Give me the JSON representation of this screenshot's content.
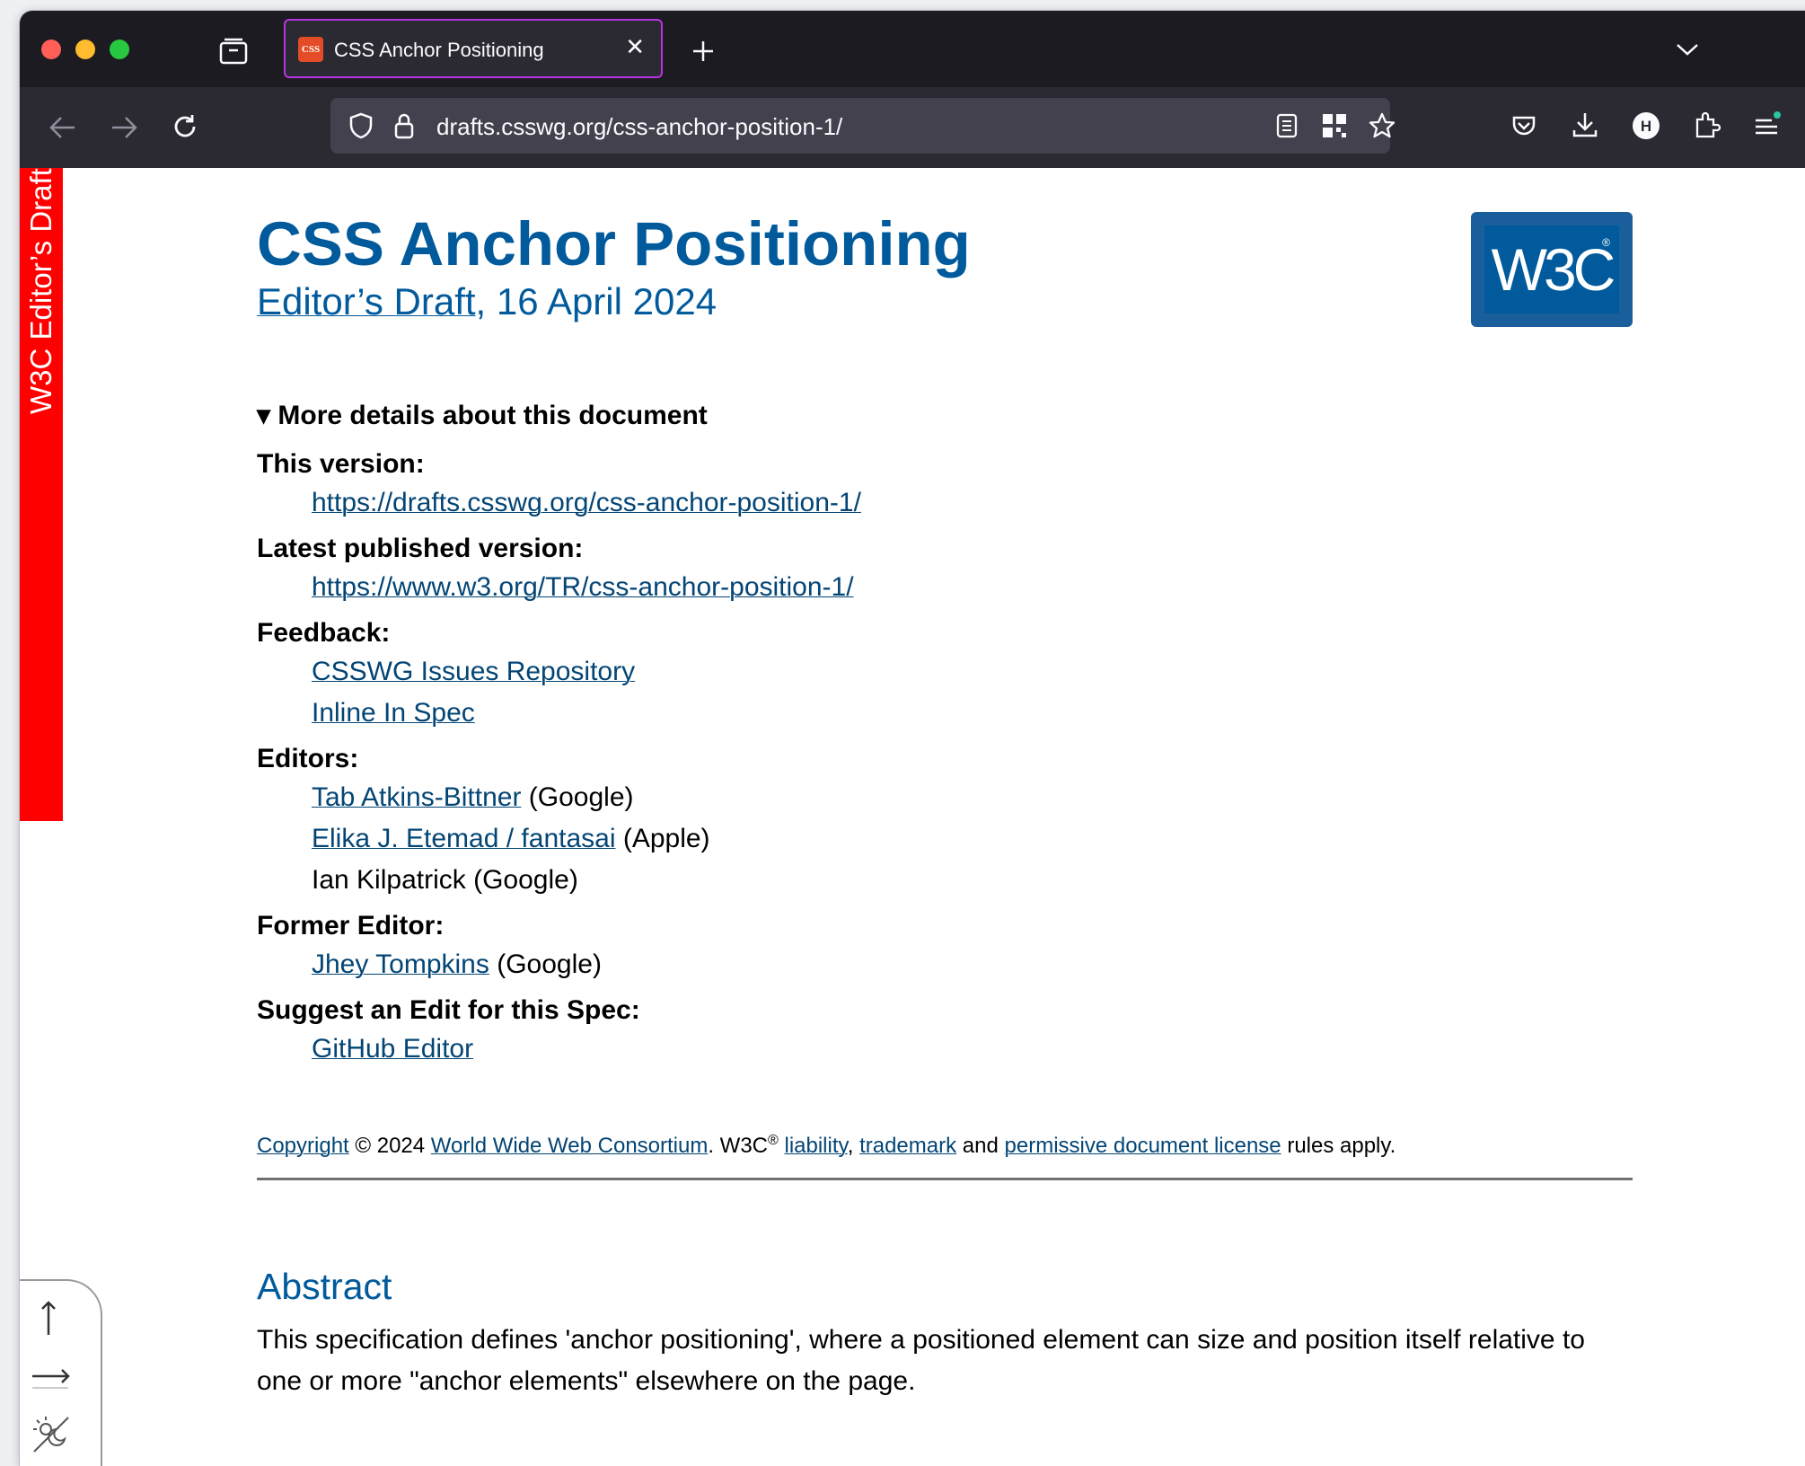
{
  "browser": {
    "tab_title": "CSS Anchor Positioning",
    "tab_favicon_text": "CSS",
    "url": "drafts.csswg.org/css-anchor-position-1/"
  },
  "page": {
    "ribbon": "W3C Editor’s Draft",
    "title": "CSS Anchor Positioning",
    "subtitle_link": "Editor’s Draft",
    "subtitle_date": ", 16 April 2024",
    "logo_text": "W3C",
    "logo_mark": "®",
    "details_summary": "▾ More details about this document",
    "details": {
      "this_version_label": "This version:",
      "this_version_url": "https://drafts.csswg.org/css-anchor-position-1/",
      "latest_label": "Latest published version:",
      "latest_url": "https://www.w3.org/TR/css-anchor-position-1/",
      "feedback_label": "Feedback:",
      "feedback_items": [
        "CSSWG Issues Repository",
        "Inline In Spec"
      ],
      "editors_label": "Editors:",
      "editors": [
        {
          "name": "Tab Atkins-Bittner",
          "org": " (Google)"
        },
        {
          "name": "Elika J. Etemad / fantasai",
          "org": " (Apple)"
        },
        {
          "name": "Ian Kilpatrick",
          "org": " (Google)"
        }
      ],
      "former_editor_label": "Former Editor:",
      "former_editor": {
        "name": "Jhey Tompkins",
        "org": " (Google)"
      },
      "suggest_label": "Suggest an Edit for this Spec:",
      "suggest_link": "GitHub Editor"
    },
    "copyright": {
      "copyright_link": "Copyright",
      "year_text": " © 2024 ",
      "consortium": "World Wide Web Consortium",
      "w3c": ". W3C",
      "reg": "®",
      "liability": "liability",
      "comma": ", ",
      "trademark": "trademark",
      "and": " and ",
      "license": "permissive document license",
      "rules": " rules apply."
    },
    "abstract_title": "Abstract",
    "abstract_text": "This specification defines 'anchor positioning', where a positioned element can size and position itself relative to one or more \"anchor elements\" elsewhere on the page."
  },
  "colors": {
    "heading_blue": "#005a9c",
    "link_blue": "#034575",
    "ribbon_red": "#ff0000",
    "tab_highlight": "#b833e1",
    "browser_dark": "#1c1b22"
  },
  "icons": [
    "sidebar-tabs-icon",
    "new-tab-icon",
    "tab-list-chevron-icon",
    "back-icon",
    "forward-icon",
    "reload-icon",
    "shield-icon",
    "lock-icon",
    "reader-view-icon",
    "qr-code-icon",
    "bookmark-star-icon",
    "pocket-icon",
    "download-icon",
    "account-icon",
    "extensions-icon",
    "menu-icon",
    "arrow-up-icon",
    "arrow-right-icon",
    "dark-mode-icon"
  ]
}
